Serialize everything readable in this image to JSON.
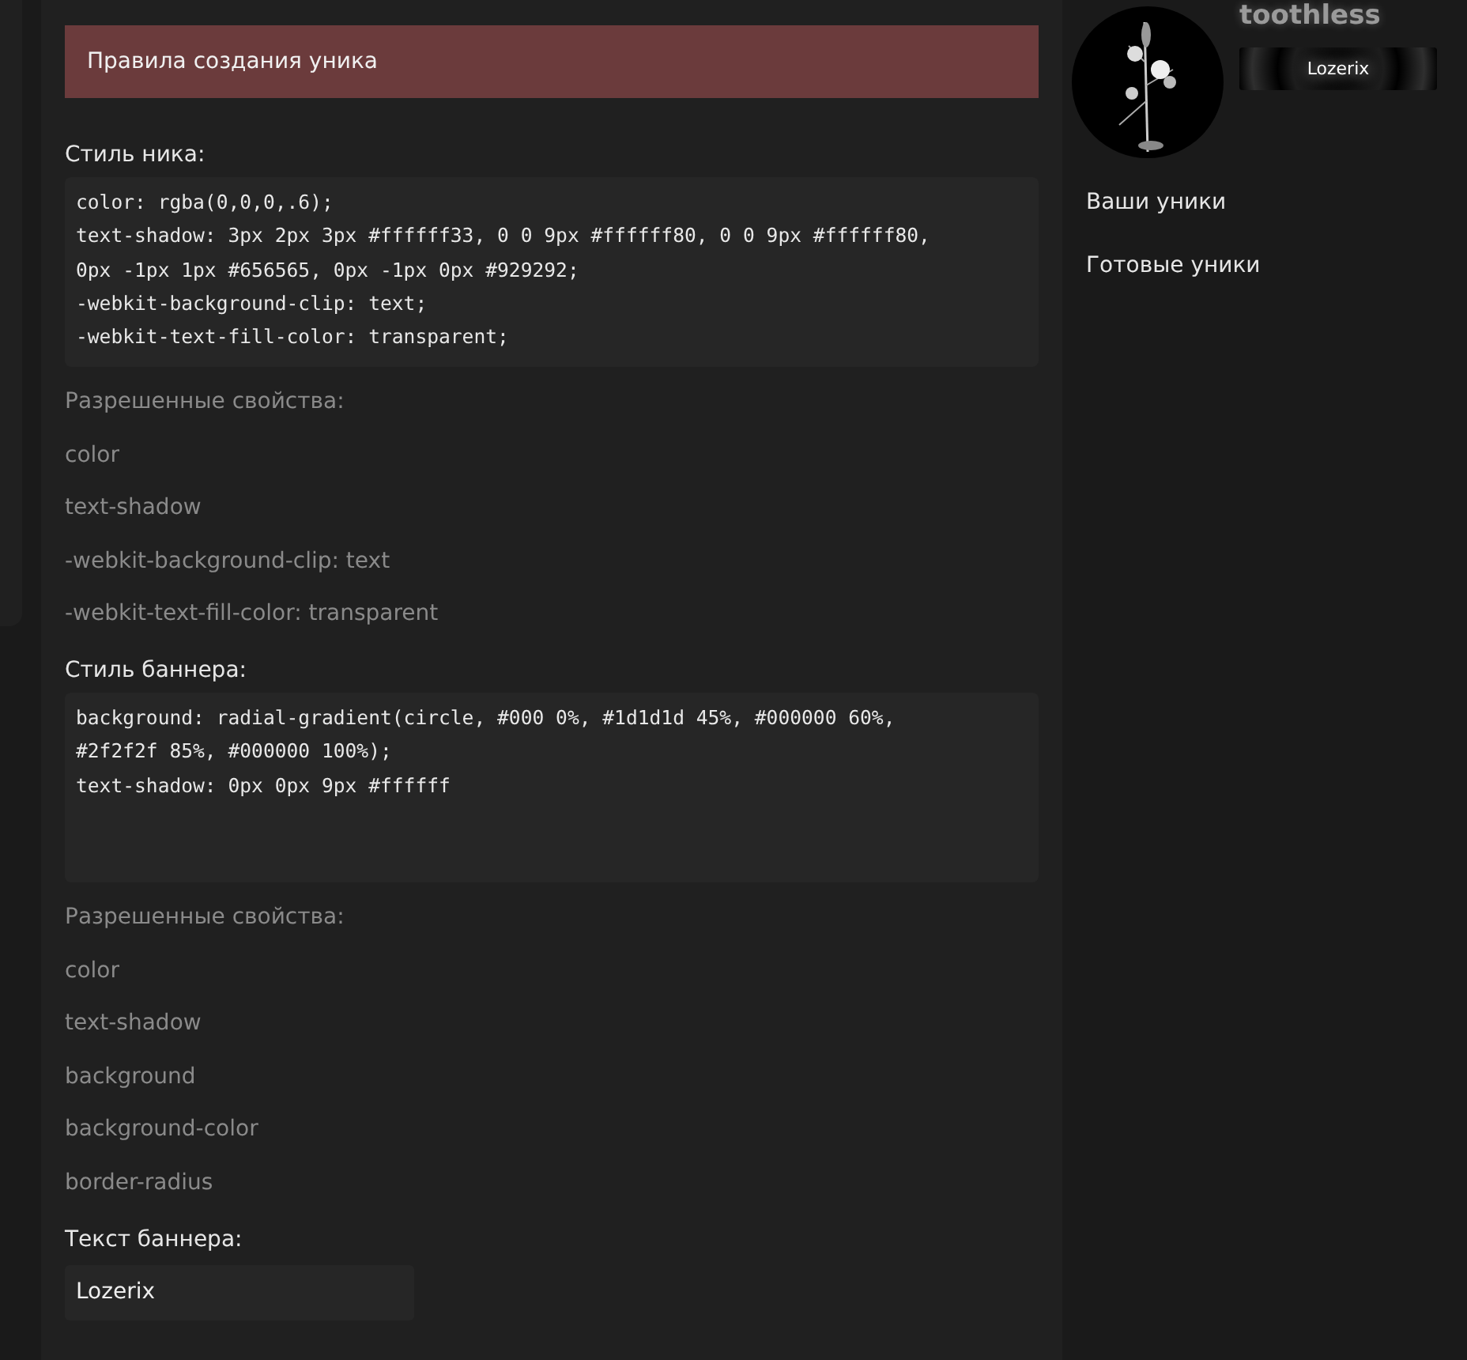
{
  "rules_banner": {
    "title": "Правила создания уника"
  },
  "nick_style": {
    "label": "Стиль ника:",
    "value": "color: rgba(0,0,0,.6);\ntext-shadow: 3px 2px 3px #ffffff33, 0 0 9px #ffffff80, 0 0 9px #ffffff80,\n0px -1px 1px #656565, 0px -1px 0px #929292;\n-webkit-background-clip: text;\n-webkit-text-fill-color: transparent;",
    "allowed_title": "Разрешенные свойства:",
    "allowed": [
      "color",
      "text-shadow",
      "-webkit-background-clip: text",
      "-webkit-text-fill-color: transparent"
    ]
  },
  "banner_style": {
    "label": "Стиль баннера:",
    "value": "background: radial-gradient(circle, #000 0%, #1d1d1d 45%, #000000 60%,\n#2f2f2f 85%, #000000 100%);\ntext-shadow: 0px 0px 9px #ffffff",
    "allowed_title": "Разрешенные свойства:",
    "allowed": [
      "color",
      "text-shadow",
      "background",
      "background-color",
      "border-radius"
    ]
  },
  "banner_text": {
    "label": "Текст баннера:",
    "value": "Lozerix"
  },
  "profile": {
    "nick": "toothless",
    "banner": "Lozerix"
  },
  "menu": [
    {
      "label": "Ваши уники"
    },
    {
      "label": "Готовые уники"
    }
  ]
}
